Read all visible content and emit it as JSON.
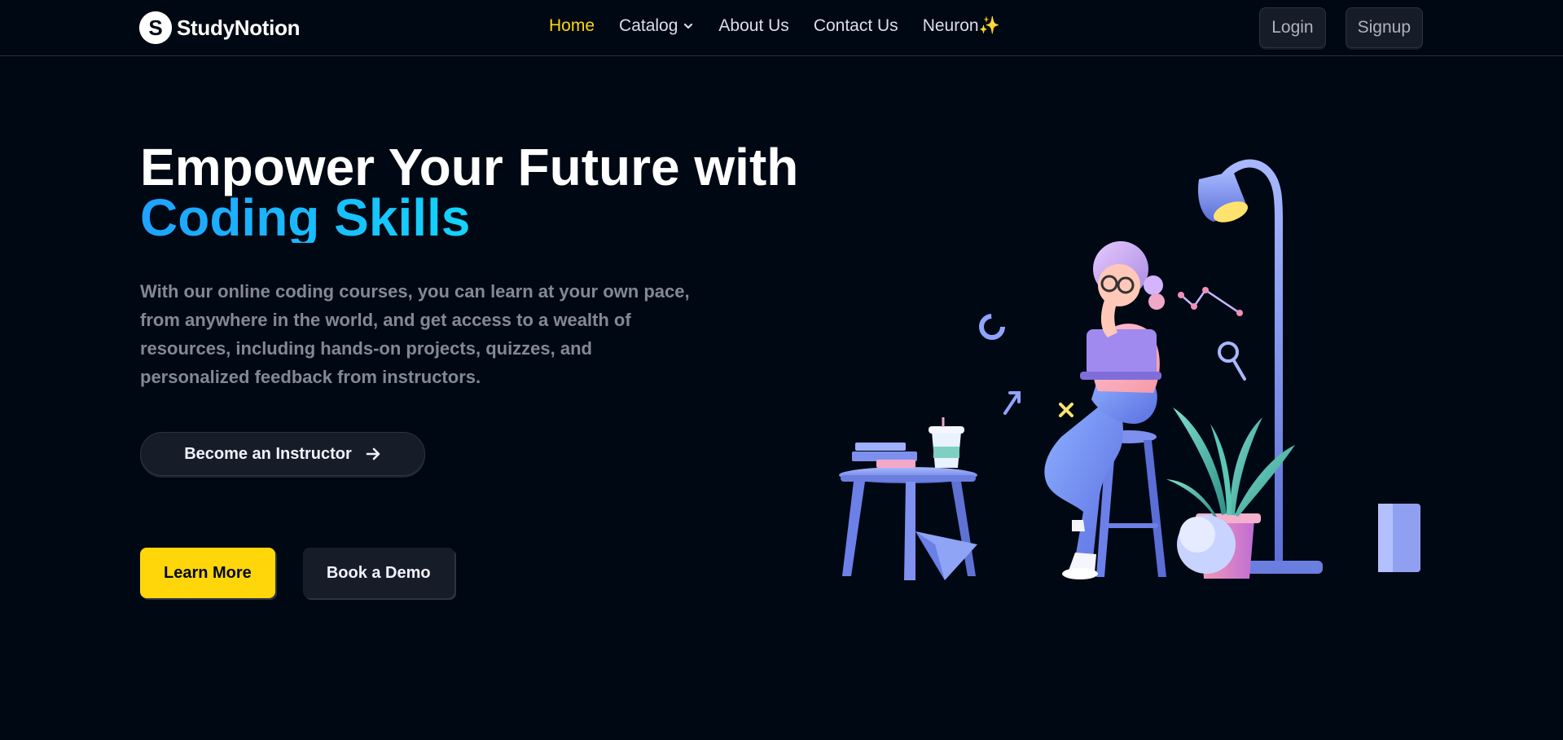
{
  "brand": {
    "name": "StudyNotion",
    "logo_letter": "S"
  },
  "nav": {
    "links": [
      {
        "label": "Home",
        "active": true
      },
      {
        "label": "Catalog",
        "has_dropdown": true
      },
      {
        "label": "About Us"
      },
      {
        "label": "Contact Us"
      },
      {
        "label": "Neuron✨"
      }
    ],
    "login_label": "Login",
    "signup_label": "Signup"
  },
  "hero": {
    "title_line1": "Empower Your Future with",
    "title_line2": "Coding Skills",
    "description": "With our online coding courses, you can learn at your own pace, from anywhere in the world, and get access to a wealth of resources, including hands-on projects, quizzes, and personalized feedback from instructors.",
    "instructor_button": "Become an Instructor",
    "learn_more": "Learn More",
    "book_demo": "Book a Demo"
  },
  "colors": {
    "background": "#000814",
    "accent_yellow": "#ffd60a",
    "gradient": [
      "#1fa2ff",
      "#12d8fa",
      "#a6ffcb"
    ],
    "button_dark": "#161d29",
    "muted_text": "#838894"
  },
  "icons": {
    "catalog_dropdown": "chevron-down-icon",
    "instructor_arrow": "arrow-right-icon",
    "illustration": "girl-with-laptop-illustration"
  }
}
